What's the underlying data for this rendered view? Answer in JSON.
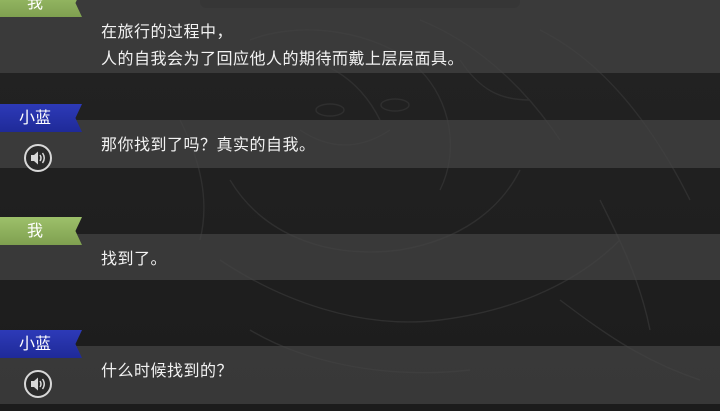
{
  "log": [
    {
      "speaker": "我",
      "speaker_type": "me",
      "lines": [
        "在旅行的过程中，",
        "人的自我会为了回应他人的期待而戴上层层面具。"
      ],
      "has_voice": false
    },
    {
      "speaker": "小蓝",
      "speaker_type": "lan",
      "lines": [
        "那你找到了吗？真实的自我。"
      ],
      "has_voice": true
    },
    {
      "speaker": "我",
      "speaker_type": "me",
      "lines": [
        "找到了。"
      ],
      "has_voice": false
    },
    {
      "speaker": "小蓝",
      "speaker_type": "lan",
      "lines": [
        "什么时候找到的？"
      ],
      "has_voice": true
    }
  ],
  "icons": {
    "voice": "speaker-volume-icon"
  },
  "colors": {
    "me_tag": "#8fb05c",
    "lan_tag": "#2430a8",
    "band": "#444444",
    "text": "#f2f2f2"
  }
}
